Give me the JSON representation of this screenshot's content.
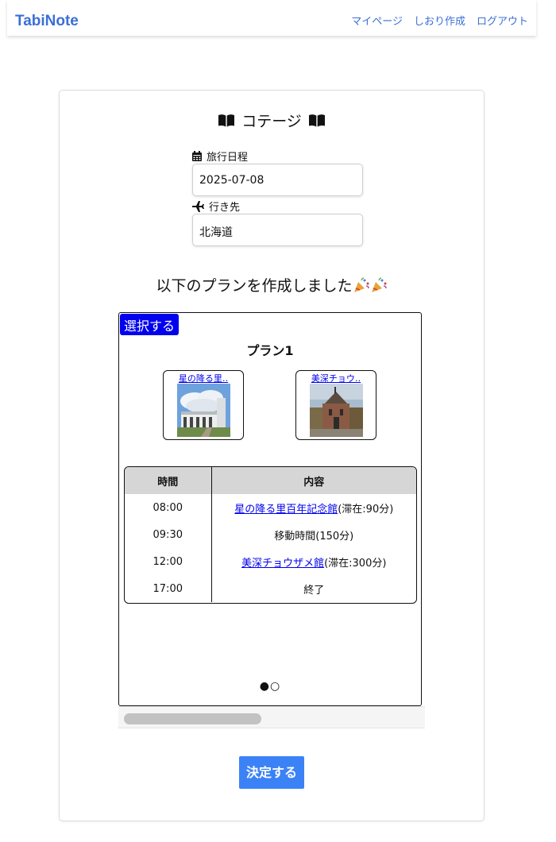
{
  "nav": {
    "brand": "TabiNote",
    "links": [
      "マイページ",
      "しおり作成",
      "ログアウト"
    ]
  },
  "card": {
    "title": "コテージ",
    "date_label": "旅行日程",
    "date_value": "2025-07-08",
    "destination_label": "行き先",
    "destination_value": "北海道",
    "result_heading": "以下のプランを作成しました"
  },
  "plan": {
    "select_label": "選択する",
    "title": "プラン1",
    "spots": [
      {
        "label": "星の降る里‥"
      },
      {
        "label": "美深チョウ‥"
      }
    ],
    "table": {
      "headers": [
        "時間",
        "内容"
      ],
      "rows": [
        {
          "time": "08:00",
          "link": "星の降る里百年記念館",
          "suffix": "(滞在:90分)"
        },
        {
          "time": "09:30",
          "text": "移動時間(150分)"
        },
        {
          "time": "12:00",
          "link": "美深チョウザメ館",
          "suffix": "(滞在:300分)"
        },
        {
          "time": "17:00",
          "text": "終了"
        }
      ]
    },
    "dots": "●○"
  },
  "decide_label": "決定する",
  "colors": {
    "brand": "#3b6fd6",
    "select": "#0000ee",
    "decide": "#3b82f6"
  }
}
